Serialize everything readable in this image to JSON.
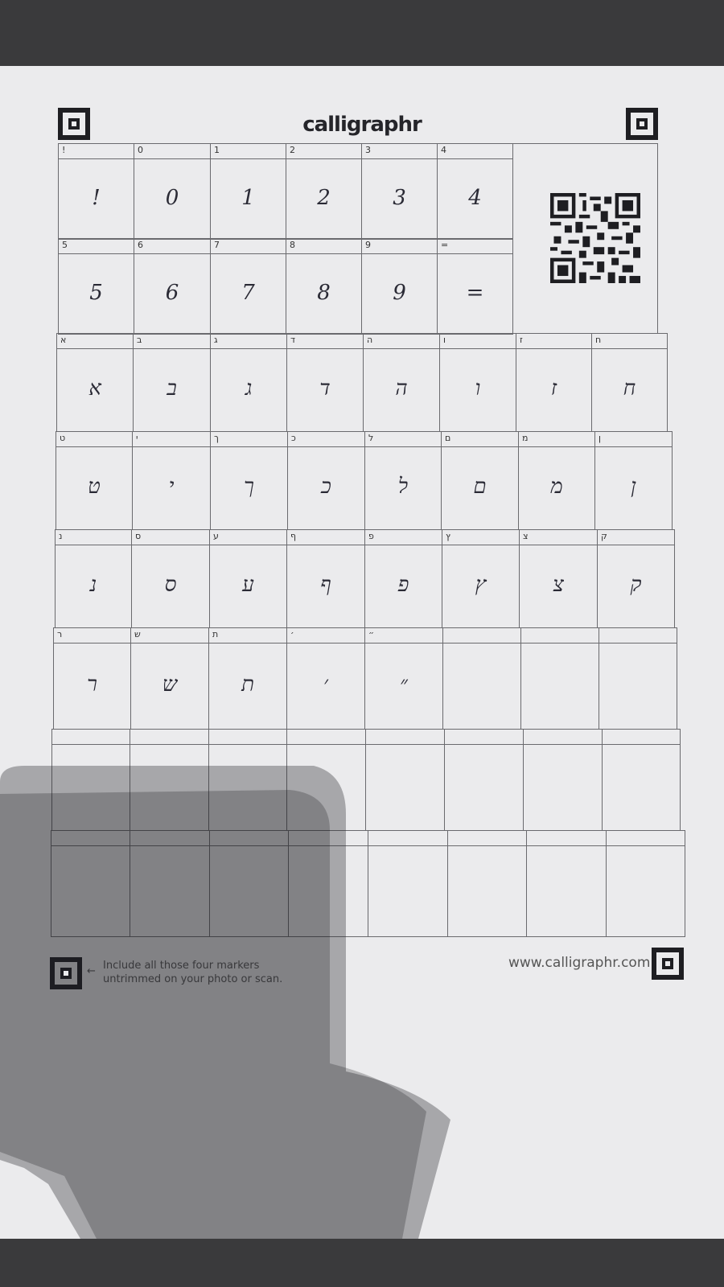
{
  "logo": "calligraphr",
  "cells": [
    {
      "label": "!",
      "glyph": "!"
    },
    {
      "label": "0",
      "glyph": "0"
    },
    {
      "label": "1",
      "glyph": "1"
    },
    {
      "label": "2",
      "glyph": "2"
    },
    {
      "label": "3",
      "glyph": "3"
    },
    {
      "label": "4",
      "glyph": "4"
    },
    {
      "label": "5",
      "glyph": "5"
    },
    {
      "label": "6",
      "glyph": "6"
    },
    {
      "label": "7",
      "glyph": "7"
    },
    {
      "label": "8",
      "glyph": "8"
    },
    {
      "label": "9",
      "glyph": "9"
    },
    {
      "label": "=",
      "glyph": "="
    },
    {
      "label": "א",
      "glyph": "א"
    },
    {
      "label": "ב",
      "glyph": "ב"
    },
    {
      "label": "ג",
      "glyph": "ג"
    },
    {
      "label": "ד",
      "glyph": "ד"
    },
    {
      "label": "ה",
      "glyph": "ה"
    },
    {
      "label": "ו",
      "glyph": "ו"
    },
    {
      "label": "ז",
      "glyph": "ז"
    },
    {
      "label": "ח",
      "glyph": "ח"
    },
    {
      "label": "ט",
      "glyph": "ט"
    },
    {
      "label": "י",
      "glyph": "י"
    },
    {
      "label": "ך",
      "glyph": "ך"
    },
    {
      "label": "כ",
      "glyph": "כ"
    },
    {
      "label": "ל",
      "glyph": "ל"
    },
    {
      "label": "ם",
      "glyph": "ם"
    },
    {
      "label": "מ",
      "glyph": "מ"
    },
    {
      "label": "ן",
      "glyph": "ן"
    },
    {
      "label": "נ",
      "glyph": "נ"
    },
    {
      "label": "ס",
      "glyph": "ס"
    },
    {
      "label": "ע",
      "glyph": "ע"
    },
    {
      "label": "ף",
      "glyph": "ף"
    },
    {
      "label": "פ",
      "glyph": "פ"
    },
    {
      "label": "ץ",
      "glyph": "ץ"
    },
    {
      "label": "צ",
      "glyph": "צ"
    },
    {
      "label": "ק",
      "glyph": "ק"
    },
    {
      "label": "ר",
      "glyph": "ר"
    },
    {
      "label": "ש",
      "glyph": "ש"
    },
    {
      "label": "ת",
      "glyph": "ת"
    },
    {
      "label": "׳",
      "glyph": "׳"
    },
    {
      "label": "״",
      "glyph": "״"
    }
  ],
  "footer": {
    "note_line1": "Include all those four markers",
    "note_line2": "untrimmed on your photo or scan.",
    "arrow": "←",
    "url": "www.calligraphr.com"
  }
}
